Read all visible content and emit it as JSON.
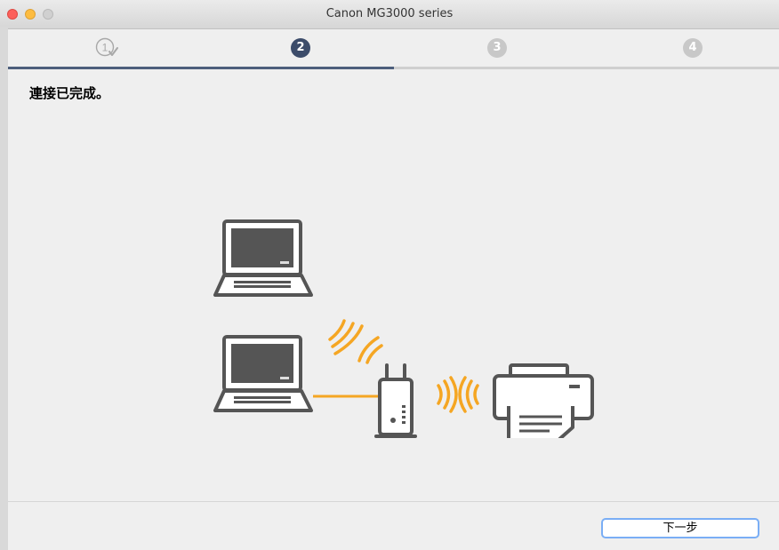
{
  "window": {
    "title": "Canon MG3000 series"
  },
  "steps": [
    {
      "label": "1",
      "state": "done"
    },
    {
      "label": "2",
      "state": "current"
    },
    {
      "label": "3",
      "state": "pending"
    },
    {
      "label": "4",
      "state": "pending"
    }
  ],
  "progress": {
    "fraction": 0.5
  },
  "message": "連接已完成。",
  "illustration": {
    "icons": [
      "laptop-icon",
      "laptop-icon",
      "router-icon",
      "printer-icon",
      "wireless-signal-icon"
    ]
  },
  "footer": {
    "next_label": "下一步"
  },
  "colors": {
    "accent": "#3c4c6a",
    "signal": "#f5a623",
    "button_focus": "#7aaef5"
  }
}
